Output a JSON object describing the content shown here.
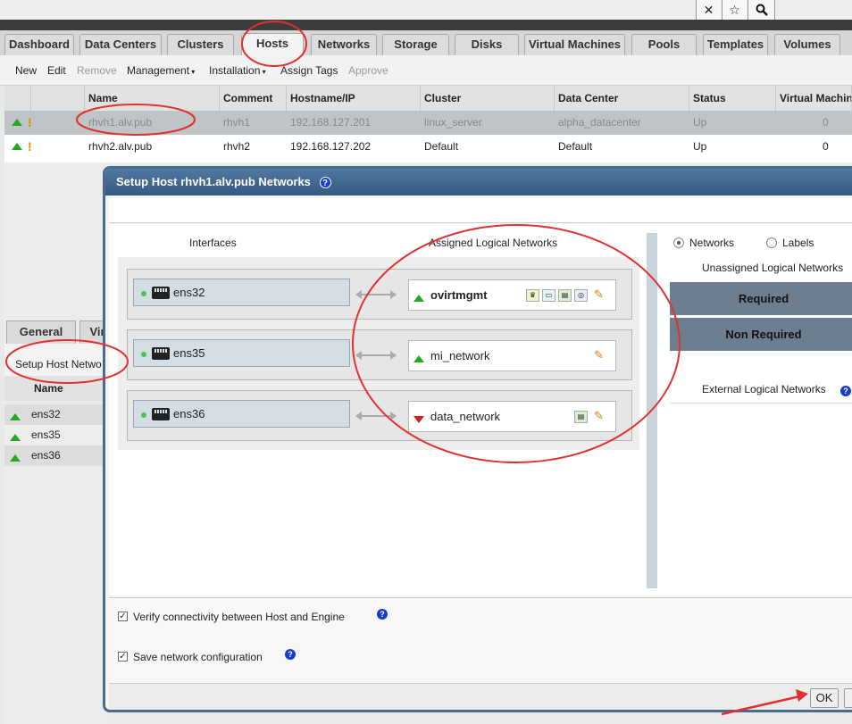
{
  "window_controls": {
    "close": "✕",
    "star": "☆",
    "search": "🔍"
  },
  "tabs": [
    "Dashboard",
    "Data Centers",
    "Clusters",
    "Hosts",
    "Networks",
    "Storage",
    "Disks",
    "Virtual Machines",
    "Pools",
    "Templates",
    "Volumes"
  ],
  "toolbar": {
    "new": "New",
    "edit": "Edit",
    "remove": "Remove",
    "management": "Management",
    "installation": "Installation",
    "assign_tags": "Assign Tags",
    "approve": "Approve"
  },
  "grid": {
    "headers": [
      "Name",
      "Comment",
      "Hostname/IP",
      "Cluster",
      "Data Center",
      "Status",
      "Virtual Machin"
    ],
    "rows": [
      {
        "name": "rhvh1.alv.pub",
        "comment": "rhvh1",
        "ip": "192.168.127.201",
        "cluster": "linux_server",
        "dc": "alpha_datacenter",
        "status": "Up",
        "vms": "0"
      },
      {
        "name": "rhvh2.alv.pub",
        "comment": "rhvh2",
        "ip": "192.168.127.202",
        "cluster": "Default",
        "dc": "Default",
        "status": "Up",
        "vms": "0"
      }
    ]
  },
  "lower": {
    "tab_general": "General",
    "tab_vir": "Vir",
    "action": "Setup Host Netwo",
    "col_name": "Name",
    "items": [
      "ens32",
      "ens35",
      "ens36"
    ]
  },
  "dialog": {
    "title": "Setup Host rhvh1.alv.pub Networks",
    "help": "?",
    "col_interfaces": "Interfaces",
    "col_assigned": "Assigned Logical Networks",
    "rows": [
      {
        "iface": "ens32",
        "network": "ovirtmgmt",
        "arrow": "up"
      },
      {
        "iface": "ens35",
        "network": "mi_network",
        "arrow": "up"
      },
      {
        "iface": "ens36",
        "network": "data_network",
        "arrow": "down"
      }
    ],
    "radio_networks": "Networks",
    "radio_labels": "Labels",
    "unassigned": "Unassigned Logical Networks",
    "required": "Required",
    "non_required": "Non Required",
    "external": "External Logical Networks",
    "verify": "Verify connectivity between Host and Engine",
    "save": "Save network configuration",
    "ok": "OK",
    "cancel": "C"
  },
  "annotation_color": "#e03030"
}
